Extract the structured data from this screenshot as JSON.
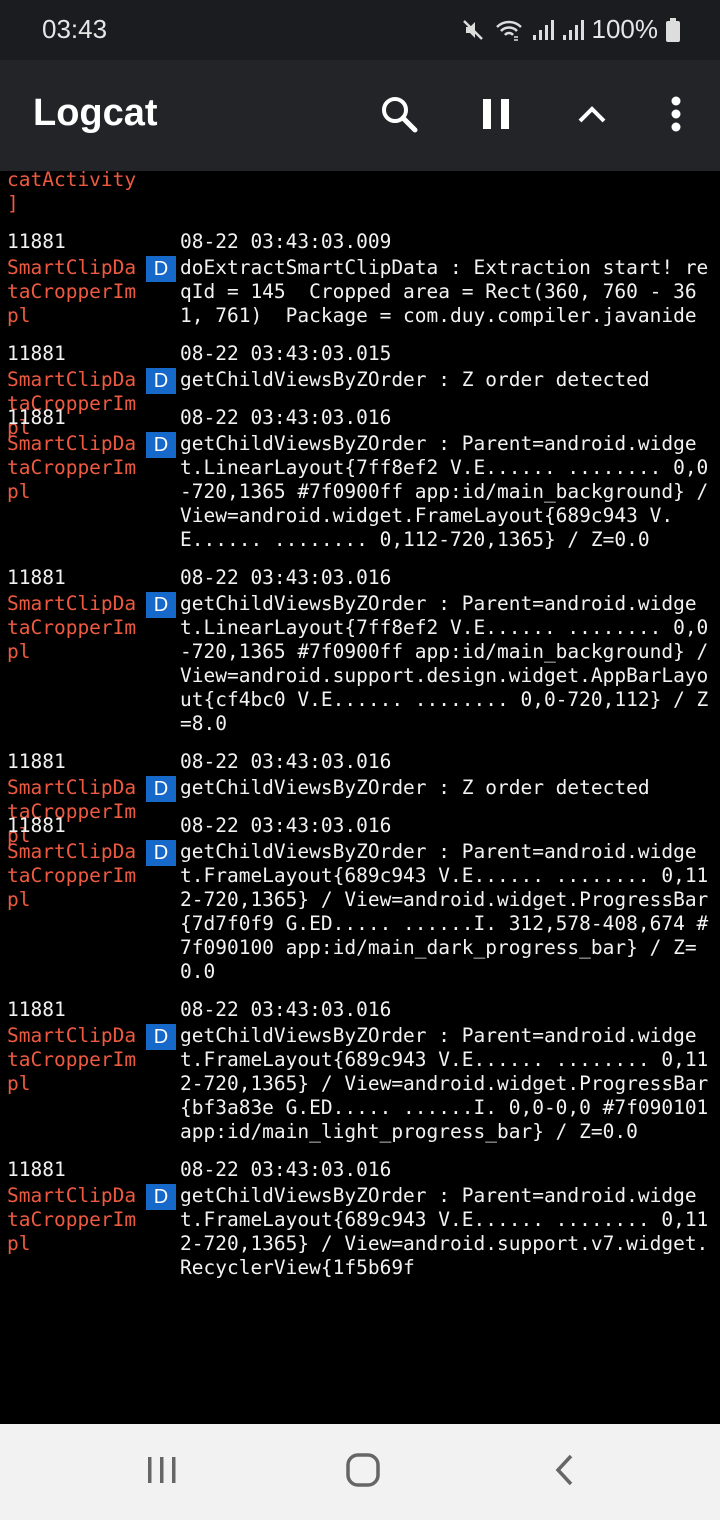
{
  "status_bar": {
    "time": "03:43",
    "battery": "100%"
  },
  "app_bar": {
    "title": "Logcat",
    "actions": [
      "search-icon",
      "pause-icon",
      "chevron-up-icon",
      "more-vert-icon"
    ]
  },
  "log": {
    "partial_top": {
      "tag_lines": [
        "catActivity",
        "]"
      ]
    },
    "entries": [
      {
        "pid": "11881",
        "timestamp": "08-22 03:43:03.009",
        "tag": "SmartClipDataCropperImpl",
        "level": "D",
        "message": "doExtractSmartClipData : Extraction start! reqId = 145  Cropped area = Rect(360, 760 - 361, 761)  Package = com.duy.compiler.javanide"
      },
      {
        "pid": "11881",
        "timestamp": "08-22 03:43:03.015",
        "tag": "SmartClipDataCropperImpl",
        "level": "D",
        "message": "getChildViewsByZOrder : Z order detected"
      },
      {
        "pid": "11881",
        "timestamp": "08-22 03:43:03.016",
        "tag": "SmartClipDataCropperImpl",
        "level": "D",
        "message": "getChildViewsByZOrder : Parent=android.widget.LinearLayout{7ff8ef2 V.E...... ........ 0,0-720,1365 #7f0900ff app:id/main_background} / View=android.widget.FrameLayout{689c943 V.E...... ........ 0,112-720,1365} / Z=0.0"
      },
      {
        "pid": "11881",
        "timestamp": "08-22 03:43:03.016",
        "tag": "SmartClipDataCropperImpl",
        "level": "D",
        "message": "getChildViewsByZOrder : Parent=android.widget.LinearLayout{7ff8ef2 V.E...... ........ 0,0-720,1365 #7f0900ff app:id/main_background} / View=android.support.design.widget.AppBarLayout{cf4bc0 V.E...... ........ 0,0-720,112} / Z=8.0"
      },
      {
        "pid": "11881",
        "timestamp": "08-22 03:43:03.016",
        "tag": "SmartClipDataCropperImpl",
        "level": "D",
        "message": "getChildViewsByZOrder : Z order detected"
      },
      {
        "pid": "11881",
        "timestamp": "08-22 03:43:03.016",
        "tag": "SmartClipDataCropperImpl",
        "level": "D",
        "message": "getChildViewsByZOrder : Parent=android.widget.FrameLayout{689c943 V.E...... ........ 0,112-720,1365} / View=android.widget.ProgressBar{7d7f0f9 G.ED..... ......I. 312,578-408,674 #7f090100 app:id/main_dark_progress_bar} / Z=0.0"
      },
      {
        "pid": "11881",
        "timestamp": "08-22 03:43:03.016",
        "tag": "SmartClipDataCropperImpl",
        "level": "D",
        "message": "getChildViewsByZOrder : Parent=android.widget.FrameLayout{689c943 V.E...... ........ 0,112-720,1365} / View=android.widget.ProgressBar{bf3a83e G.ED..... ......I. 0,0-0,0 #7f090101 app:id/main_light_progress_bar} / Z=0.0"
      },
      {
        "pid": "11881",
        "timestamp": "08-22 03:43:03.016",
        "tag": "SmartClipDataCropperImpl",
        "level": "D",
        "message": "getChildViewsByZOrder : Parent=android.widget.FrameLayout{689c943 V.E...... ........ 0,112-720,1365} / View=android.support.v7.widget.RecyclerView{1f5b69f"
      }
    ]
  },
  "nav_bar": {
    "buttons": [
      "recents-icon",
      "home-icon",
      "back-icon"
    ]
  }
}
